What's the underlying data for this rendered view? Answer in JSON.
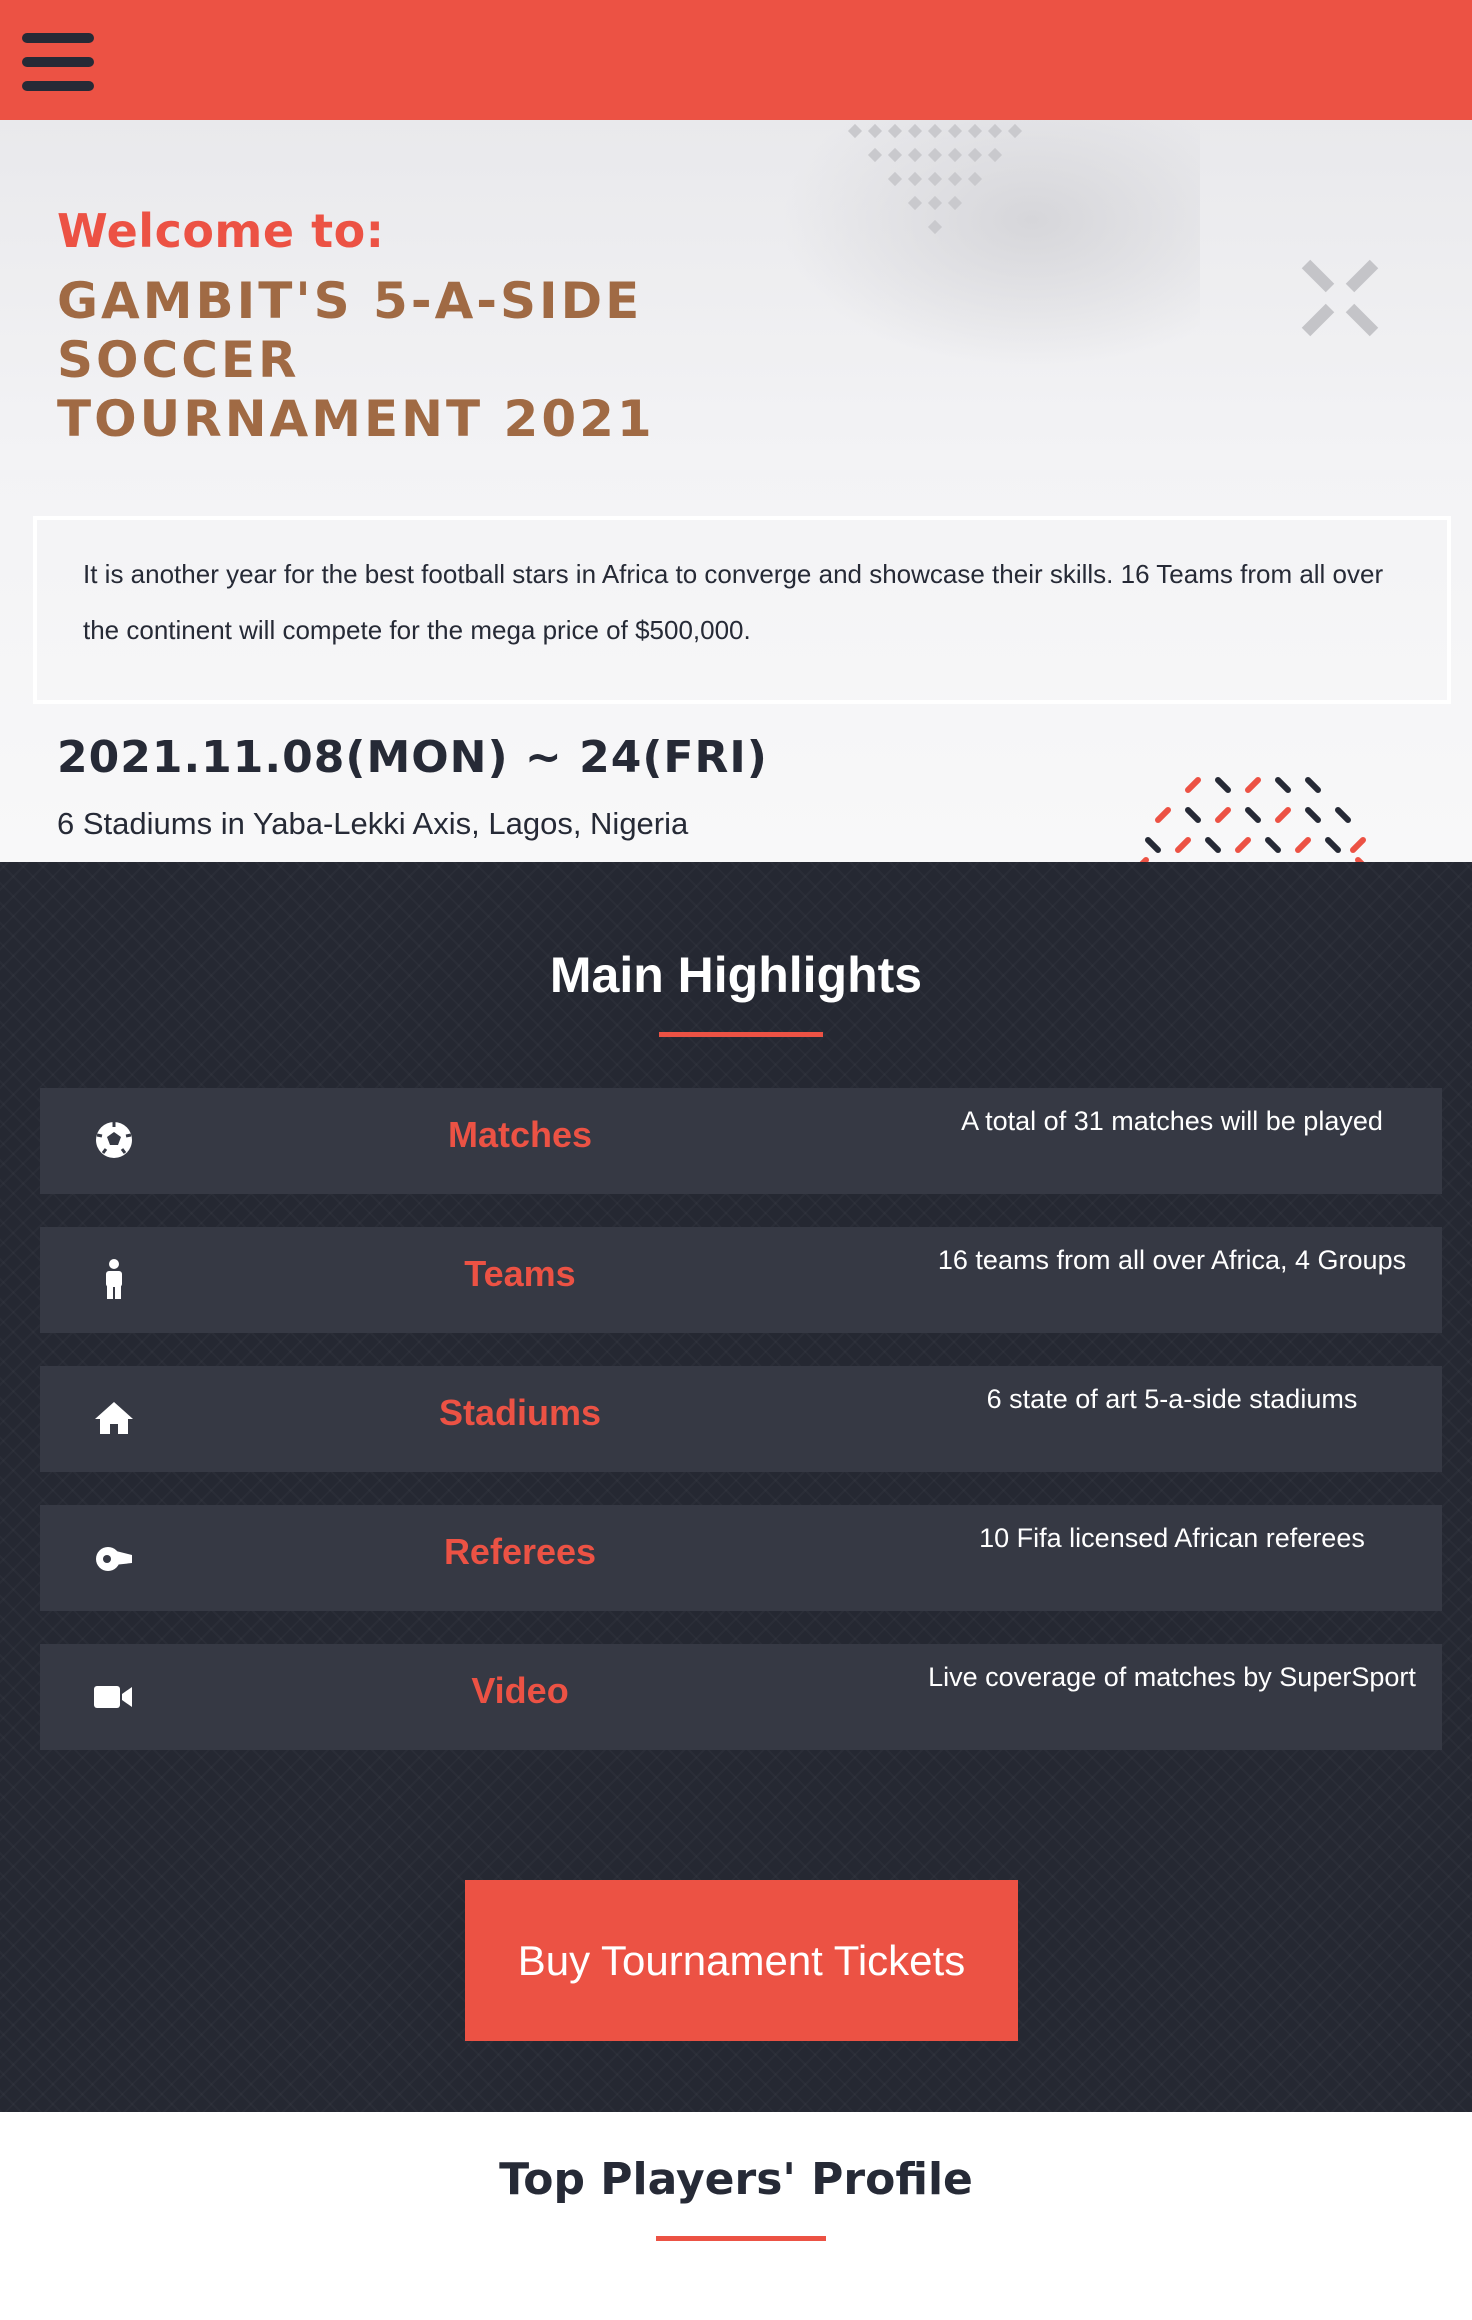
{
  "colors": {
    "accent": "#ec5244",
    "dark": "#252832",
    "card": "#363944",
    "title_brown": "#a06a44"
  },
  "header": {
    "menu_icon": "hamburger-menu-icon"
  },
  "hero": {
    "welcome": "Welcome to:",
    "title": "Gambit's 5-A-SIDE SOCCER TOURNAMENT 2021",
    "intro": "It is another year for the best football stars in Africa to converge and showcase their skills. 16 Teams from all over the continent will compete for the mega price of $500,000.",
    "dates": "2021.11.08(MON) ~ 24(FRI)",
    "venue": "6 Stadiums in Yaba-Lekki Axis, Lagos, Nigeria"
  },
  "highlights": {
    "title": "Main Highlights",
    "items": [
      {
        "icon": "soccer-ball-icon",
        "label": "Matches",
        "desc": "A total of 31 matches will be played"
      },
      {
        "icon": "person-icon",
        "label": "Teams",
        "desc": "16 teams from all over Africa, 4 Groups"
      },
      {
        "icon": "home-icon",
        "label": "Stadiums",
        "desc": "6 state of art 5-a-side stadiums"
      },
      {
        "icon": "whistle-icon",
        "label": "Referees",
        "desc": "10 Fifa licensed African referees"
      },
      {
        "icon": "video-camera-icon",
        "label": "Video",
        "desc": "Live coverage of matches by SuperSport"
      }
    ],
    "cta": "Buy Tournament Tickets"
  },
  "players": {
    "title": "Top Players' Profile"
  }
}
